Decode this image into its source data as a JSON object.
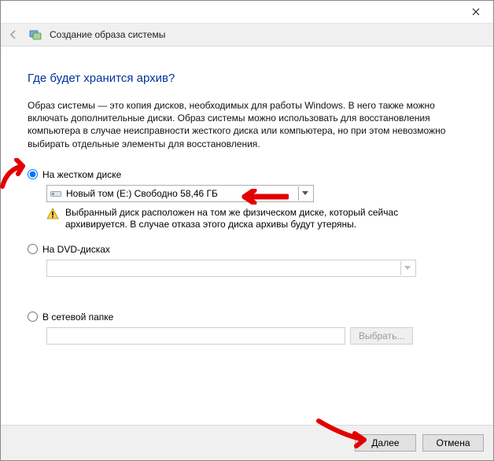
{
  "header": {
    "wizard_title": "Создание образа системы"
  },
  "main": {
    "heading": "Где будет хранится архив?",
    "description": "Образ системы — это копия дисков, необходимых для работы Windows. В него также можно включать дополнительные диски. Образ системы можно использовать для восстановления компьютера в случае неисправности жесткого диска или компьютера, но при этом невозможно выбирать отдельные элементы для восстановления.",
    "options": {
      "hdd": {
        "label": "На жестком диске",
        "selected_display": "Новый том (E:)  Свободно 58,46 ГБ",
        "warning": "Выбранный диск расположен на том же физическом диске, который сейчас архивируется. В случае отказа этого диска архивы будут утеряны."
      },
      "dvd": {
        "label": "На DVD-дисках"
      },
      "net": {
        "label": "В сетевой папке",
        "browse_label": "Выбрать..."
      }
    }
  },
  "footer": {
    "next": "Далее",
    "cancel": "Отмена"
  }
}
